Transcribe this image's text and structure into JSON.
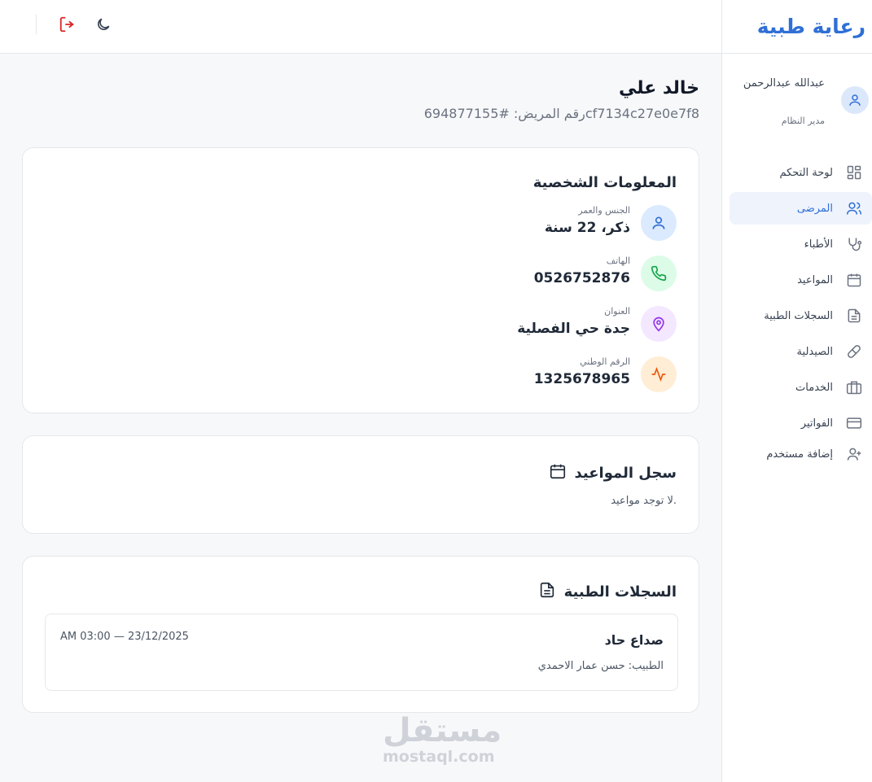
{
  "brand": {
    "title": "رعاية طبية"
  },
  "user": {
    "name": "عبدالله عبدالرحمن",
    "role": "مدير النظام"
  },
  "nav": {
    "items": [
      {
        "label": "لوحة التحكم",
        "icon": "dashboard-icon"
      },
      {
        "label": "المرضى",
        "icon": "users-icon",
        "active": true
      },
      {
        "label": "الأطباء",
        "icon": "stethoscope-icon"
      },
      {
        "label": "المواعيد",
        "icon": "calendar-icon"
      },
      {
        "label": "السجلات الطبية",
        "icon": "file-text-icon"
      },
      {
        "label": "الصيدلية",
        "icon": "pill-icon"
      },
      {
        "label": "الخدمات",
        "icon": "briefcase-icon"
      },
      {
        "label": "الفواتير",
        "icon": "credit-card-icon"
      },
      {
        "label": "إضافة مستخدم",
        "icon": "user-plus-icon"
      }
    ]
  },
  "header": {
    "icons": [
      "logout-icon",
      "moon-icon"
    ]
  },
  "patient": {
    "name": "خالد علي",
    "id_line": "رقم المريض: #694877155cf7134c27e0e7f8"
  },
  "personal_info": {
    "title": "المعلومات الشخصية",
    "fields": [
      {
        "label": "الجنس والعمر",
        "value": "ذكر، 22 سنة",
        "icon": "user-icon",
        "color": "#dbeafe",
        "icon_color": "#2f6fd6"
      },
      {
        "label": "الهاتف",
        "value": "0526752876",
        "icon": "phone-icon",
        "color": "#dcfce7",
        "icon_color": "#16a34a"
      },
      {
        "label": "العنوان",
        "value": "جدة حي الفصلية",
        "icon": "map-pin-icon",
        "color": "#f3e8ff",
        "icon_color": "#9333ea"
      },
      {
        "label": "الرقم الوطني",
        "value": "1325678965",
        "icon": "activity-icon",
        "color": "#ffedd5",
        "icon_color": "#ea580c"
      }
    ]
  },
  "appointments": {
    "title": "سجل المواعيد",
    "empty": "لا توجد مواعيد."
  },
  "records": {
    "title": "السجلات الطبية",
    "items": [
      {
        "title": "صداع حاد",
        "doctor": "الطبيب: حسن عمار الاحمدي",
        "date": "AM 03:00 — 23/12/2025"
      }
    ]
  },
  "watermark": {
    "ar": "مستقل",
    "en": "mostaql.com"
  }
}
